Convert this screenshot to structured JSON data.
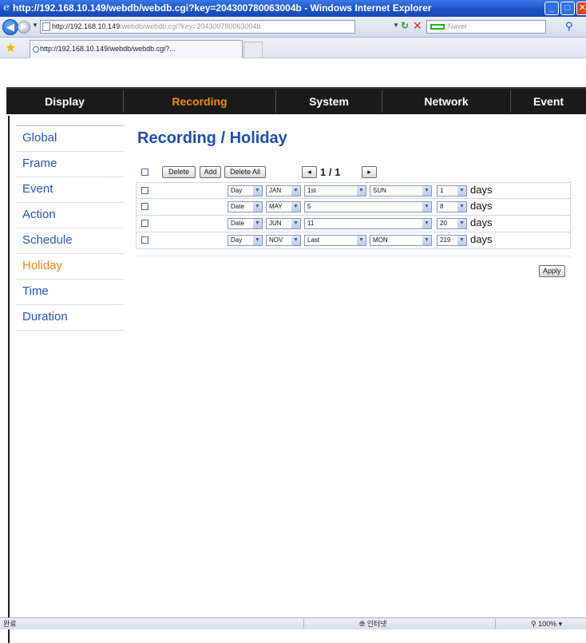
{
  "window": {
    "title": "http://192.168.10.149/webdb/webdb.cgi?key=204300780063004b - Windows Internet Explorer"
  },
  "address": {
    "url_host": "http://192.168.10.149",
    "url_path": "/webdb/webdb.cgi?key=204300780063004b",
    "search_placeholder": "Naver"
  },
  "tab": {
    "label": "http://192.168.10.149/webdb/webdb.cgi?..."
  },
  "menu": {
    "items": [
      {
        "label": "Display"
      },
      {
        "label": "Recording"
      },
      {
        "label": "System"
      },
      {
        "label": "Network"
      },
      {
        "label": "Event"
      }
    ],
    "active": "Recording"
  },
  "sidebar": {
    "items": [
      {
        "label": "Global"
      },
      {
        "label": "Frame"
      },
      {
        "label": "Event"
      },
      {
        "label": "Action"
      },
      {
        "label": "Schedule"
      },
      {
        "label": "Holiday"
      },
      {
        "label": "Time"
      },
      {
        "label": "Duration"
      }
    ],
    "active": "Holiday"
  },
  "page": {
    "title": "Recording / Holiday"
  },
  "toolbar": {
    "delete_label": "Delete",
    "add_label": "Add",
    "delete_all_label": "Delete All",
    "pager_text": "1 / 1"
  },
  "holidays": [
    {
      "type": "Day",
      "month": "JAN",
      "day": "1st",
      "weekday": "SUN",
      "count": "1",
      "unit": "days"
    },
    {
      "type": "Date",
      "month": "MAY",
      "day": "5",
      "weekday": "",
      "count": "8",
      "unit": "days"
    },
    {
      "type": "Date",
      "month": "JUN",
      "day": "11",
      "weekday": "",
      "count": "20",
      "unit": "days"
    },
    {
      "type": "Day",
      "month": "NOV",
      "day": "Last",
      "weekday": "MON",
      "count": "219",
      "unit": "days"
    }
  ],
  "apply_label": "Apply",
  "status": {
    "left": "완료",
    "zone": "인터넷",
    "zoom": "100%"
  },
  "colors": {
    "accent_orange": "#f08c1e",
    "link_blue": "#2456b8",
    "menubar_bg": "#1a1a1a"
  }
}
